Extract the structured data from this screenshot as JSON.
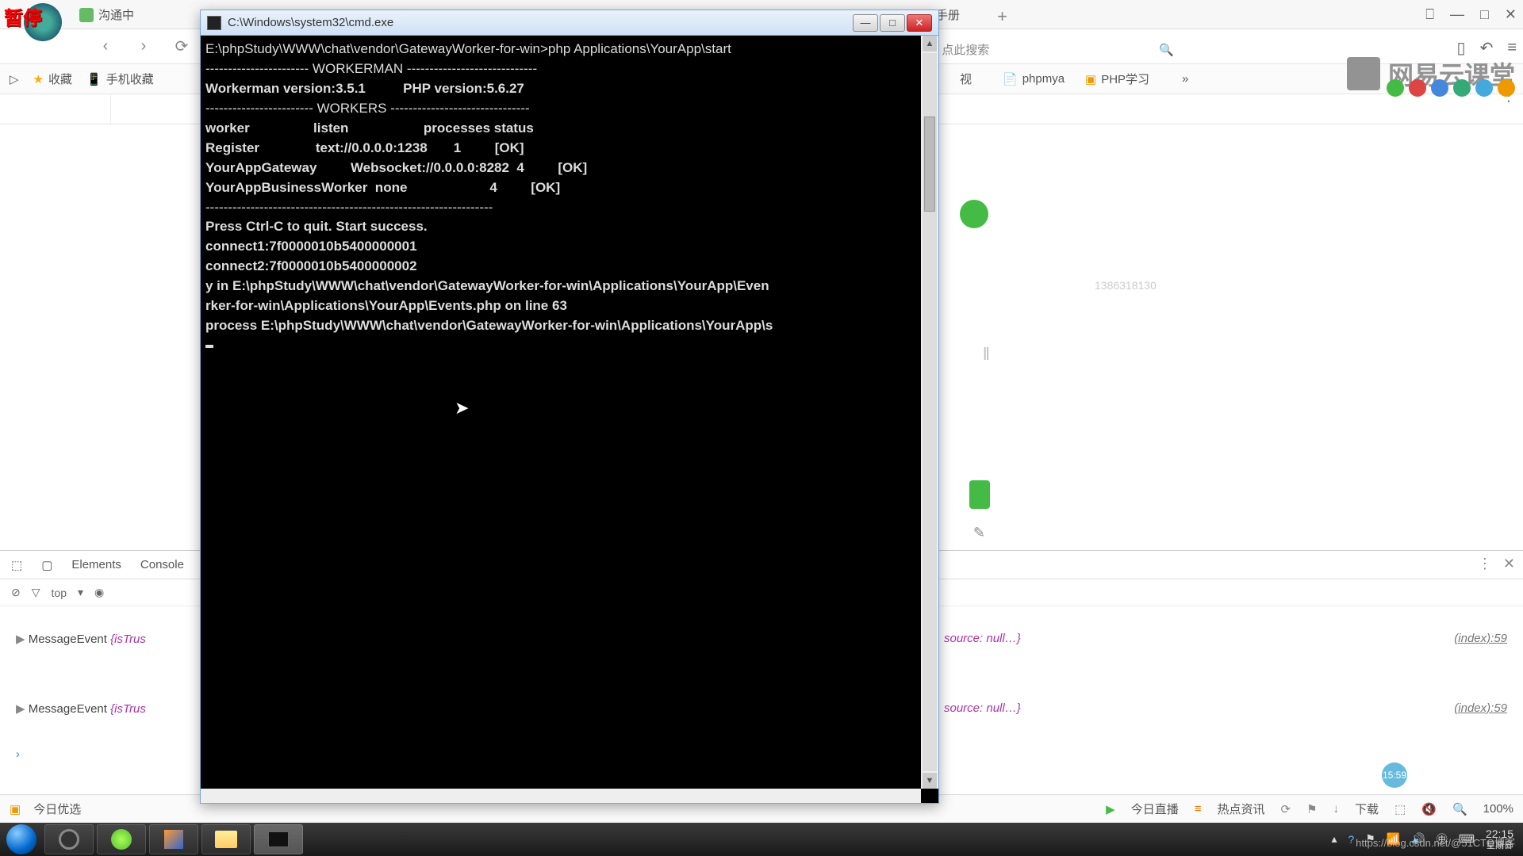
{
  "pause_label": "暂停",
  "chat_tab": "沟通中",
  "right_tab": "GatewayWorker手册",
  "toolbar": {
    "search_hint": "点此搜索"
  },
  "bookmarks": {
    "fav": "收藏",
    "mobile": "手机收藏",
    "phpmya": "phpmya",
    "phpstudy": "PHP学习",
    "partial": "视"
  },
  "cmd": {
    "title": "C:\\Windows\\system32\\cmd.exe",
    "lines": [
      "E:\\phpStudy\\WWW\\chat\\vendor\\GatewayWorker-for-win>php Applications\\YourApp\\start",
      "----------------------- WORKERMAN -----------------------------",
      "Workerman version:3.5.1          PHP version:5.6.27",
      "------------------------ WORKERS -------------------------------",
      "worker                 listen                    processes status",
      "Register               text://0.0.0.0:1238       1         [OK]",
      "YourAppGateway         Websocket://0.0.0.0:8282  4         [OK]",
      "YourAppBusinessWorker  none                      4         [OK]",
      "----------------------------------------------------------------",
      "Press Ctrl-C to quit. Start success.",
      "connect1:7f0000010b5400000001",
      "connect2:7f0000010b5400000002",
      "y in E:\\phpStudy\\WWW\\chat\\vendor\\GatewayWorker-for-win\\Applications\\YourApp\\Even",
      "rker-for-win\\Applications\\YourApp\\Events.php on line 63",
      "process E:\\phpStudy\\WWW\\chat\\vendor\\GatewayWorker-for-win\\Applications\\YourApp\\s"
    ]
  },
  "devtools": {
    "tabs": [
      "Elements",
      "Console"
    ],
    "filter_top": "top",
    "msg": "MessageEvent",
    "istrust": "{isTrus",
    "source": "source: null…}",
    "index_link": "(index):59"
  },
  "phone_num": "1386318130",
  "bottom_bar": {
    "today_sel": "今日优选",
    "today_live": "今日直播",
    "hot_info": "热点资讯",
    "download": "下载",
    "zoom": "100%"
  },
  "watermark": "网易云课堂",
  "blue_badge": "15:59",
  "tray": {
    "time": "22:15",
    "date": "星期日"
  },
  "csdn": "https://blog.csdn.net/@51CTO博客"
}
